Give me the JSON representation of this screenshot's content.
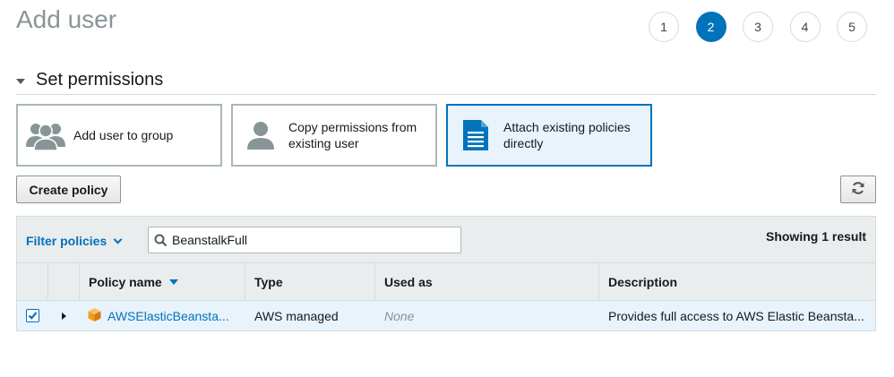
{
  "page": {
    "title": "Add user"
  },
  "steps": [
    "1",
    "2",
    "3",
    "4",
    "5"
  ],
  "active_step": "2",
  "section": {
    "title": "Set permissions"
  },
  "options": {
    "add_group": "Add user to group",
    "copy_perm": "Copy permissions from existing user",
    "attach": "Attach existing policies directly"
  },
  "toolbar": {
    "create_policy": "Create policy"
  },
  "filter": {
    "label": "Filter policies",
    "search_value": "BeanstalkFull",
    "showing": "Showing 1 result"
  },
  "table": {
    "headers": {
      "policy_name": "Policy name",
      "type": "Type",
      "used_as": "Used as",
      "description": "Description"
    },
    "rows": [
      {
        "checked": true,
        "policy_name": "AWSElasticBeansta...",
        "type": "AWS managed",
        "used_as": "None",
        "description": "Provides full access to AWS Elastic Beansta..."
      }
    ]
  },
  "colors": {
    "accent": "#0073bb",
    "selected_bg": "#e8f3fc",
    "header_bg": "#eaeded",
    "policy_icon": "#f29c1f"
  },
  "icons": {
    "group": "group-icon",
    "user": "user-icon",
    "document": "document-icon",
    "refresh": "refresh-icon",
    "search": "search-icon",
    "policy": "cube-icon"
  }
}
